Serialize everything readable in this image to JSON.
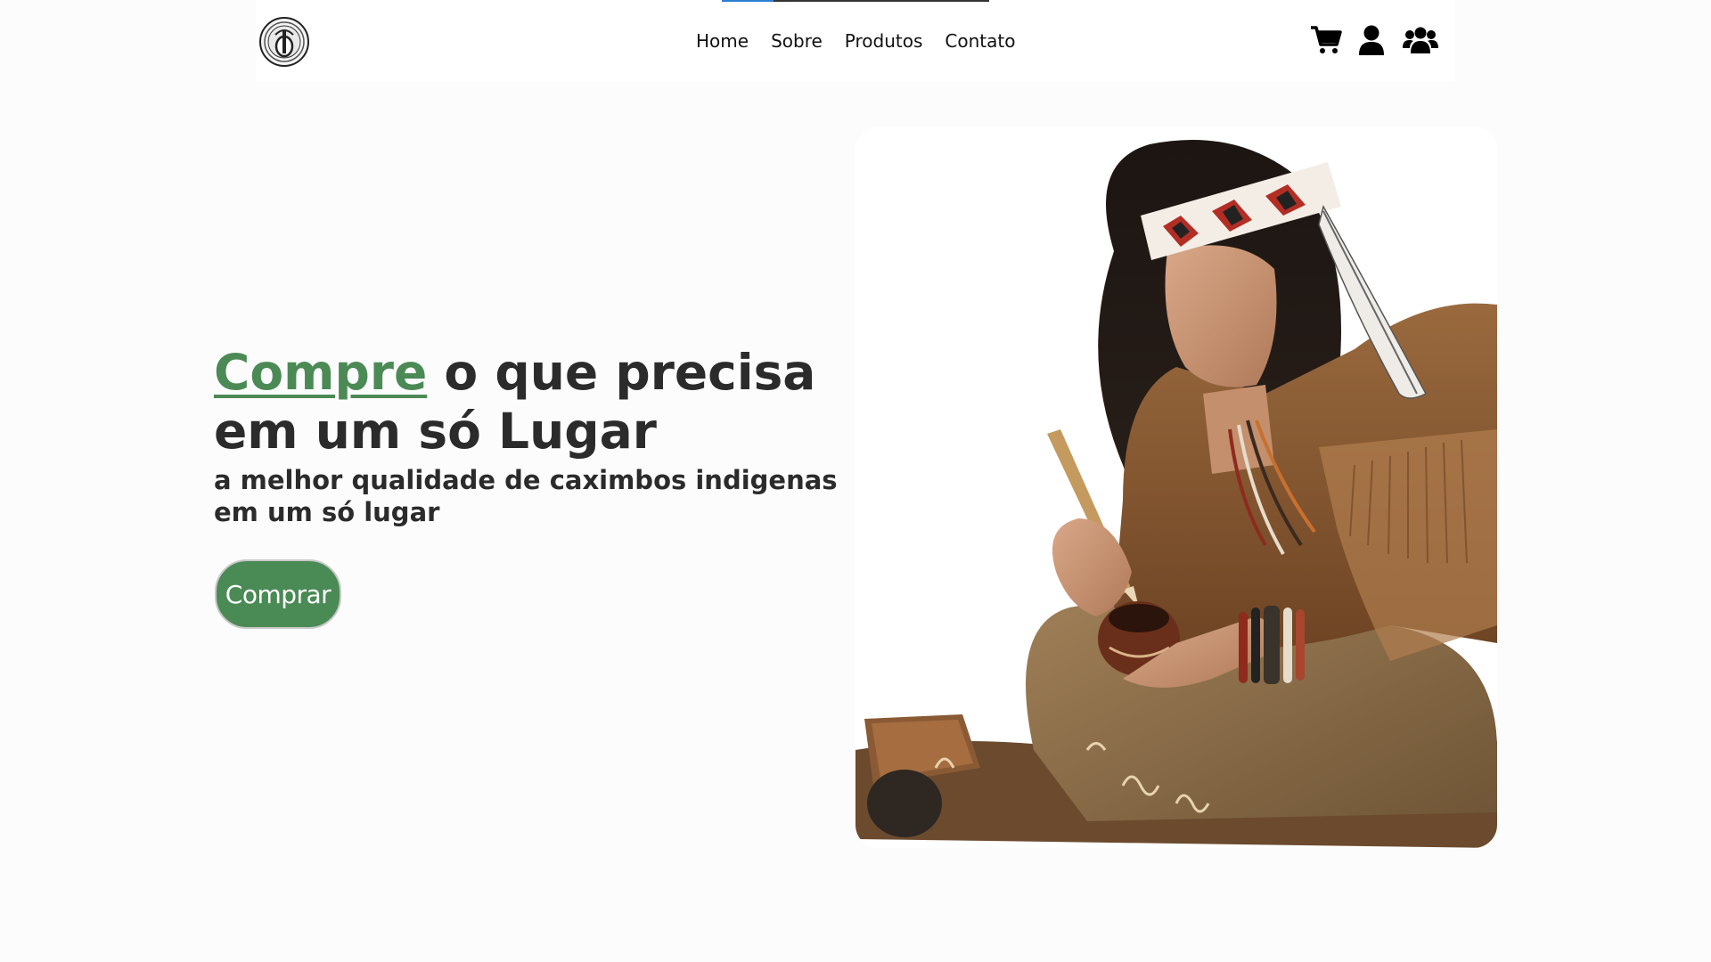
{
  "nav": {
    "links": [
      "Home",
      "Sobre",
      "Produtos",
      "Contato"
    ],
    "icons": [
      "shopping-cart-icon",
      "user-icon",
      "users-group-icon"
    ]
  },
  "hero": {
    "title_accent": "Compre",
    "title_rest": " o que precisa em um só Lugar",
    "subtitle": "a melhor qualidade de caximbos indigenas em um só lugar",
    "button_label": "Comprar"
  },
  "colors": {
    "accent_green": "#4a8a55",
    "text_dark": "#2b2b2b",
    "background": "#fcfcfc"
  }
}
